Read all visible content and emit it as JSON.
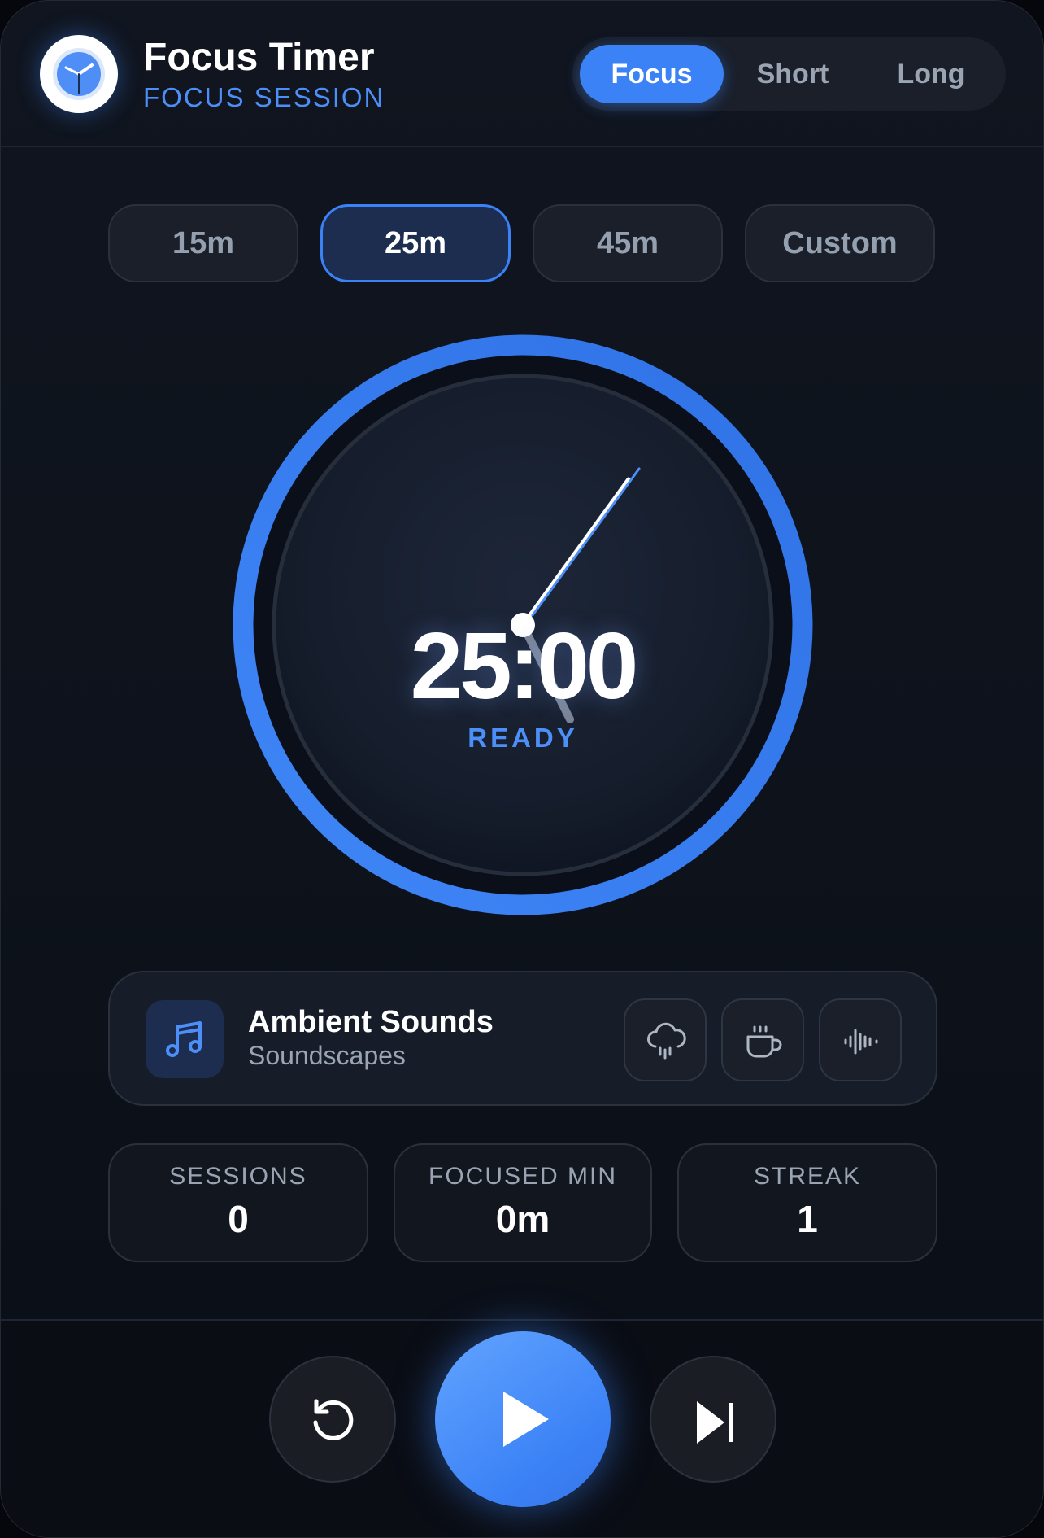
{
  "header": {
    "title": "Focus Timer",
    "subtitle": "FOCUS SESSION",
    "mode_tabs": [
      {
        "label": "Focus",
        "active": true
      },
      {
        "label": "Short",
        "active": false
      },
      {
        "label": "Long",
        "active": false
      }
    ]
  },
  "presets": [
    {
      "label": "15m",
      "active": false
    },
    {
      "label": "25m",
      "active": true
    },
    {
      "label": "45m",
      "active": false
    },
    {
      "label": "Custom",
      "active": false
    }
  ],
  "timer": {
    "display": "25:00",
    "status": "READY",
    "progress_fraction": 1.0
  },
  "ambient": {
    "title": "Ambient Sounds",
    "subtitle": "Soundscapes",
    "sounds": [
      {
        "icon": "rain-cloud-icon"
      },
      {
        "icon": "coffee-cup-icon"
      },
      {
        "icon": "waveform-icon"
      }
    ]
  },
  "stats": [
    {
      "label": "SESSIONS",
      "value": "0"
    },
    {
      "label": "FOCUSED MIN",
      "value": "0m"
    },
    {
      "label": "STREAK",
      "value": "1"
    }
  ],
  "controls": {
    "reset_icon": "reset-icon",
    "play_icon": "play-icon",
    "skip_icon": "skip-forward-icon"
  },
  "colors": {
    "accent": "#3b82f6",
    "background": "#0d121b",
    "text": "#ffffff",
    "muted": "#9aa4b2"
  }
}
